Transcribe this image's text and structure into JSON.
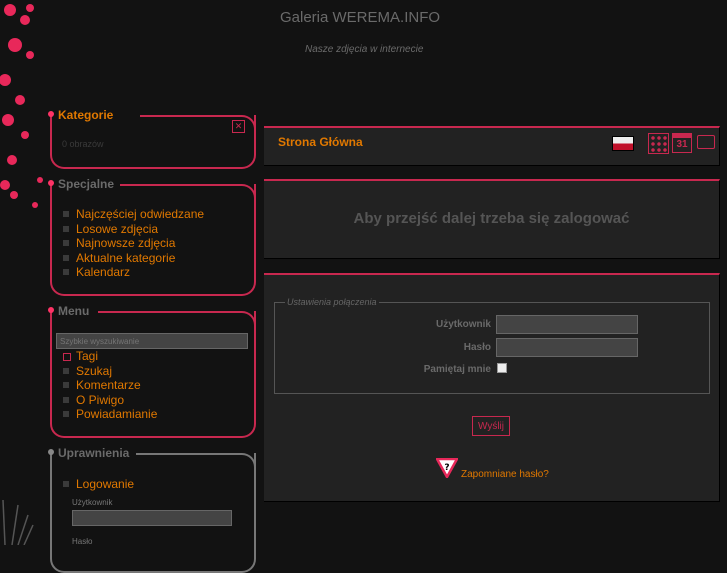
{
  "header": {
    "title": "Galeria WEREMA.INFO",
    "subtitle": "Nasze zdjęcia w internecie"
  },
  "sidebar": {
    "kategorie": {
      "title": "Kategorie",
      "count": "0 obrazów"
    },
    "specjalne": {
      "title": "Specjalne",
      "items": [
        "Najczęściej odwiedzane",
        "Losowe zdjęcia",
        "Najnowsze zdjęcia",
        "Aktualne kategorie",
        "Kalendarz"
      ]
    },
    "menu": {
      "title": "Menu",
      "search_placeholder": "Szybkie wyszukiwanie",
      "items": [
        "Tagi",
        "Szukaj",
        "Komentarze",
        "O Piwigo",
        "Powiadamianie"
      ]
    },
    "uprawnienia": {
      "title": "Uprawnienia",
      "login": "Logowanie",
      "user_label": "Użytkownik",
      "pass_label": "Hasło"
    }
  },
  "main": {
    "breadcrumb": "Strona Główna",
    "calendar_day": "31",
    "message": "Aby przejść dalej trzeba się zalogować",
    "login": {
      "legend": "Ustawienia połączenia",
      "user_label": "Użytkownik",
      "pass_label": "Hasło",
      "remember_label": "Pamiętaj mnie",
      "submit": "Wyślij",
      "forgot": "Zapomniane hasło?"
    }
  },
  "colors": {
    "accent": "#c8284f",
    "link": "#e07800",
    "bg": "#121212"
  }
}
